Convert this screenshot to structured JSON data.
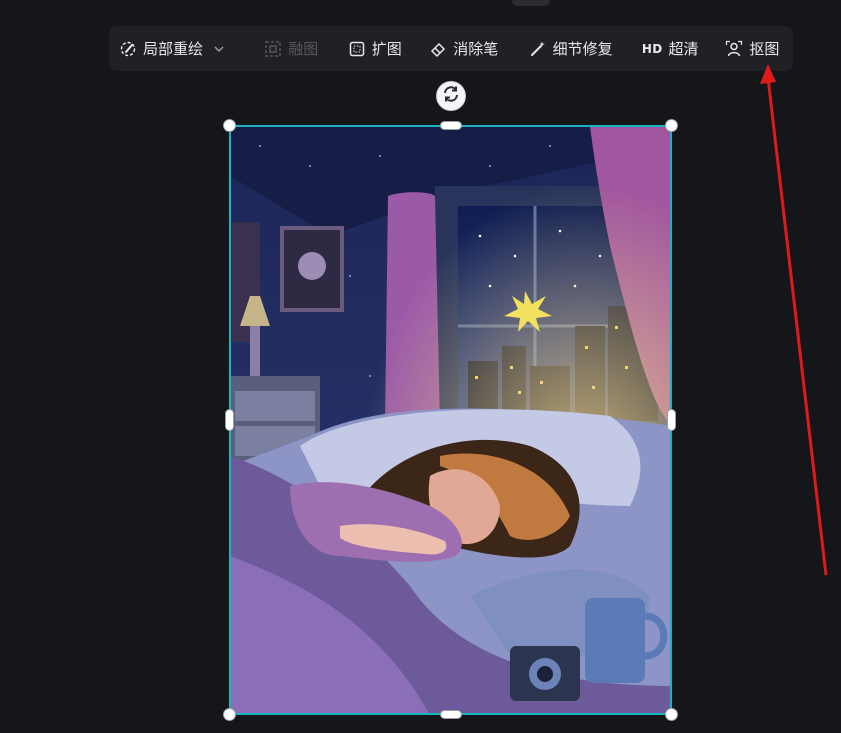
{
  "toolbar": {
    "items": [
      {
        "label": "局部重绘",
        "icon": "brush-palette-icon",
        "has_dropdown": true,
        "enabled": true
      },
      {
        "label": "融图",
        "icon": "fuse-image-icon",
        "enabled": false
      },
      {
        "label": "扩图",
        "icon": "expand-frame-icon",
        "enabled": true
      },
      {
        "label": "消除笔",
        "icon": "eraser-icon",
        "enabled": true
      },
      {
        "label": "细节修复",
        "icon": "magic-wand-icon",
        "enabled": true
      },
      {
        "label": "超清",
        "badge": "HD",
        "icon": "hd-icon",
        "enabled": true
      },
      {
        "label": "抠图",
        "icon": "cutout-person-icon",
        "enabled": true
      }
    ]
  },
  "canvas": {
    "selection_color": "#19b4bf",
    "image_description_icon": "artwork-image"
  },
  "colors": {
    "background": "#15161a",
    "toolbar": "#202126",
    "annotation_arrow": "#e01a1a"
  }
}
